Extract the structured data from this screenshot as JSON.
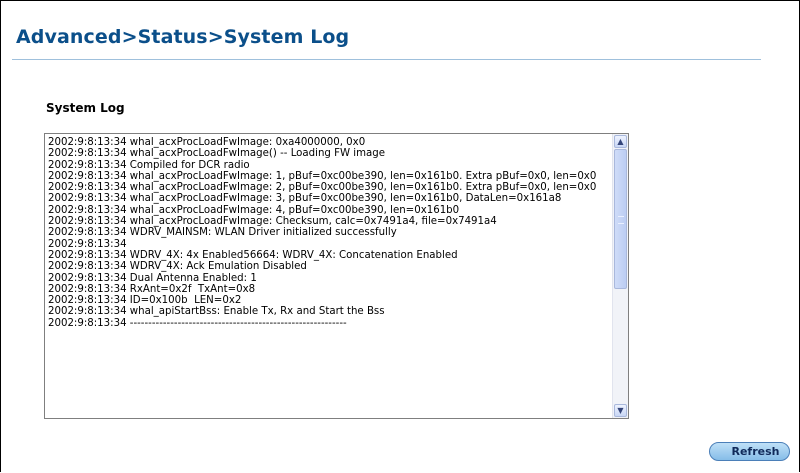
{
  "header": {
    "title": "Advanced>Status>System Log"
  },
  "section": {
    "title": "System Log"
  },
  "log": {
    "lines": [
      "2002:9:8:13:34 whal_acxProcLoadFwImage: 0xa4000000, 0x0",
      "2002:9:8:13:34 whal_acxProcLoadFwImage() -- Loading FW image",
      "2002:9:8:13:34 Compiled for DCR radio",
      "2002:9:8:13:34 whal_acxProcLoadFwImage: 1, pBuf=0xc00be390, len=0x161b0. Extra pBuf=0x0, len=0x0",
      "2002:9:8:13:34 whal_acxProcLoadFwImage: 2, pBuf=0xc00be390, len=0x161b0. Extra pBuf=0x0, len=0x0",
      "2002:9:8:13:34 whal_acxProcLoadFwImage: 3, pBuf=0xc00be390, len=0x161b0, DataLen=0x161a8",
      "2002:9:8:13:34 whal_acxProcLoadFwImage: 4, pBuf=0xc00be390, len=0x161b0",
      "2002:9:8:13:34 whal_acxProcLoadFwImage: Checksum, calc=0x7491a4, file=0x7491a4",
      "2002:9:8:13:34 WDRV_MAINSM: WLAN Driver initialized successfully",
      "2002:9:8:13:34",
      "2002:9:8:13:34 WDRV_4X: 4x Enabled56664: WDRV_4X: Concatenation Enabled",
      "2002:9:8:13:34 WDRV_4X: Ack Emulation Disabled",
      "2002:9:8:13:34 Dual Antenna Enabled: 1",
      "2002:9:8:13:34 RxAnt=0x2f  TxAnt=0x8",
      "2002:9:8:13:34 ID=0x100b  LEN=0x2",
      "2002:9:8:13:34 whal_apiStartBss: Enable Tx, Rx and Start the Bss",
      "2002:9:8:13:34 -----------------------------------------------------------"
    ]
  },
  "scroll": {
    "up_icon": "▲",
    "down_icon": "▼"
  },
  "buttons": {
    "refresh": "Refresh"
  },
  "colors": {
    "title": "#0b4f8a",
    "button": "#86bde8"
  }
}
